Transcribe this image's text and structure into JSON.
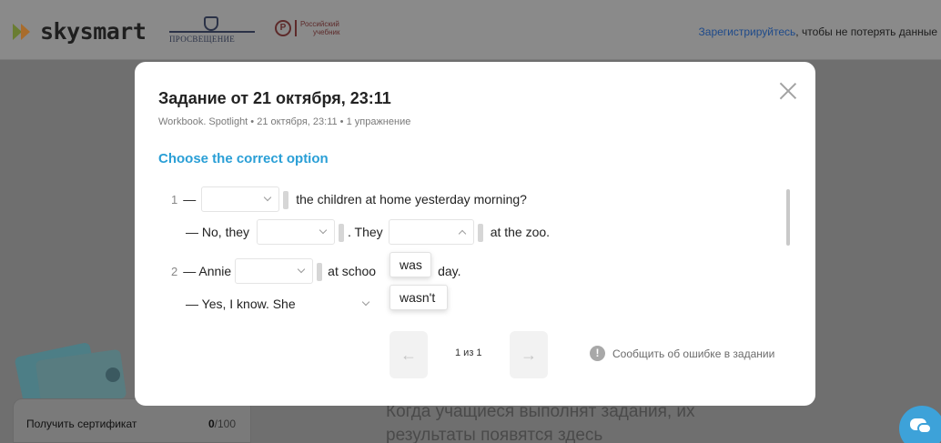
{
  "header": {
    "brand": "skysmart",
    "partner1": "ПРОСВЕЩЕНИЕ",
    "partner2_line1": "Российский",
    "partner2_line2": "учебник",
    "partner2_mark": "Р",
    "register_link": "Зарегистрируйтесь",
    "register_text": ", чтобы не потерять данные"
  },
  "background": {
    "cert_label": "Получить сертификат",
    "cert_score": "0",
    "cert_max": "/100",
    "text_line1": "Когда учащиеся выполнят задания, их",
    "text_line2": "результаты появятся здесь"
  },
  "modal": {
    "title": "Задание от 21 октября, 23:11",
    "subtitle": "Workbook. Spotlight • 21 октября, 23:11 • 1 упражнение",
    "heading": "Choose the correct option",
    "q1": {
      "num": "1",
      "dash": "—",
      "text1": "the children at home yesterday morning?",
      "line2_start": "— No, they",
      "line2_mid": ". They",
      "line2_end": "at the zoo."
    },
    "q2": {
      "num": "2",
      "start": "— Annie",
      "mid": "at schoo",
      "end": "day.",
      "line2_start": "— Yes, I know. She"
    },
    "dropdown_options": [
      "was",
      "wasn't"
    ],
    "pager": "1 из 1",
    "report": "Сообщить об ошибке в задании",
    "prev_arrow": "←",
    "next_arrow": "→"
  },
  "colors": {
    "accent": "#2a9fd6",
    "link": "#1e4a8a"
  }
}
